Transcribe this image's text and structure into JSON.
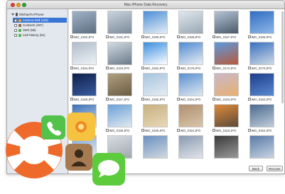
{
  "window": {
    "title": "Mac iPhone Data Recovery"
  },
  "sidebar": {
    "device": "Michael's iPhone",
    "items": [
      {
        "label": "Camera Roll (128)",
        "selected": true,
        "icon": "camera-icon",
        "color": "#f0a030"
      },
      {
        "label": "Contacts (297)",
        "selected": false,
        "icon": "contacts-icon",
        "color": "#8b6a4a"
      },
      {
        "label": "SMS (56)",
        "selected": false,
        "icon": "sms-icon",
        "color": "#4cb64a"
      },
      {
        "label": "Call History (91)",
        "selected": false,
        "icon": "call-history-icon",
        "color": "#4cb64a"
      }
    ]
  },
  "photos": [
    {
      "label": "IMG_0192.JPG",
      "colors": [
        "#9fb3c8",
        "#5e6e80"
      ]
    },
    {
      "label": "IMG_0191.JPG",
      "colors": [
        "#c9d4de",
        "#7c8b99"
      ]
    },
    {
      "label": "IMG_0189.JPG",
      "colors": [
        "#4b8fd6",
        "#e6edf5"
      ]
    },
    {
      "label": "IMG_0188.JPG",
      "colors": [
        "#dfe7ee",
        "#9aa8b5"
      ]
    },
    {
      "label": "IMG_0187.JPG",
      "colors": [
        "#b6c5d6",
        "#4a5a6a"
      ]
    },
    {
      "label": "IMG_0186.JPG",
      "colors": [
        "#2f6dc4",
        "#8fb6e6"
      ]
    },
    {
      "label": "IMG_0184.JPG",
      "colors": [
        "#aebccb",
        "#eef2f6"
      ]
    },
    {
      "label": "IMG_0183.JPG",
      "colors": [
        "#d2dbe3",
        "#6b7a88"
      ]
    },
    {
      "label": "IMG_0182.JPG",
      "colors": [
        "#3a8ee0",
        "#ffffff"
      ]
    },
    {
      "label": "IMG_0178.JPG",
      "colors": [
        "#4f8ad0",
        "#e9eef3"
      ]
    },
    {
      "label": "IMG_0173.JPG",
      "colors": [
        "#5b9be0",
        "#b85a3a"
      ]
    },
    {
      "label": "IMG_0170.JPG",
      "colors": [
        "#3770c0",
        "#cfd9e3"
      ]
    },
    {
      "label": "IMG_0168.JPG",
      "colors": [
        "#0d1f4a",
        "#3a5ca0"
      ]
    },
    {
      "label": "IMG_0167.JPG",
      "colors": [
        "#b0a080",
        "#6a5c44"
      ]
    },
    {
      "label": "IMG_0165.JPG",
      "colors": [
        "#a8c4e0",
        "#e4ecf2"
      ]
    },
    {
      "label": "IMG_0164.JPG",
      "colors": [
        "#5a8fd0",
        "#dfe8ef"
      ]
    },
    {
      "label": "IMG_0163.JPG",
      "colors": [
        "#c9b8c8",
        "#e8b070"
      ]
    },
    {
      "label": "IMG_0162.JPG",
      "colors": [
        "#1d3d8a",
        "#5a8ad0"
      ]
    },
    {
      "label": "IMG_0157.JPG",
      "colors": [
        "#3a70b8",
        "#d0dce8"
      ]
    },
    {
      "label": "IMG_0156.JPG",
      "colors": [
        "#6aa0d8",
        "#e0e8f0"
      ]
    },
    {
      "label": "IMG_0155.JPG",
      "colors": [
        "#c8b080",
        "#e6d8b8"
      ]
    },
    {
      "label": "IMG_0154.JPG",
      "colors": [
        "#b09070",
        "#d8c4a8"
      ]
    },
    {
      "label": "IMG_0153.JPG",
      "colors": [
        "#e08a3a",
        "#5a4a3a"
      ]
    },
    {
      "label": "IMG_0152.JPG",
      "colors": [
        "#4a6a90",
        "#c0ccd8"
      ]
    },
    {
      "label": "",
      "colors": [
        "#7aa6d8",
        "#e8eef4"
      ]
    },
    {
      "label": "",
      "colors": [
        "#d8dde2",
        "#a0a8b0"
      ]
    },
    {
      "label": "",
      "colors": [
        "#6a90c0",
        "#d0d8e0"
      ]
    },
    {
      "label": "",
      "colors": [
        "#8a9ab0",
        "#e0e4ea"
      ]
    },
    {
      "label": "",
      "colors": [
        "#3a3a3a",
        "#9a9a9a"
      ]
    },
    {
      "label": "",
      "colors": [
        "#5a7aa8",
        "#c8d4e0"
      ]
    }
  ],
  "buttons": {
    "back": "Back",
    "recover": "Recover"
  },
  "logo": {
    "ring_color": "#ee6a2a",
    "ring_stripe_color": "#ffffff",
    "phone_icon_color": "#53c24a",
    "photos_icon_color": "#f6c340",
    "contacts_icon_color": "#a67b52",
    "messages_icon_color": "#5ccc3c"
  }
}
